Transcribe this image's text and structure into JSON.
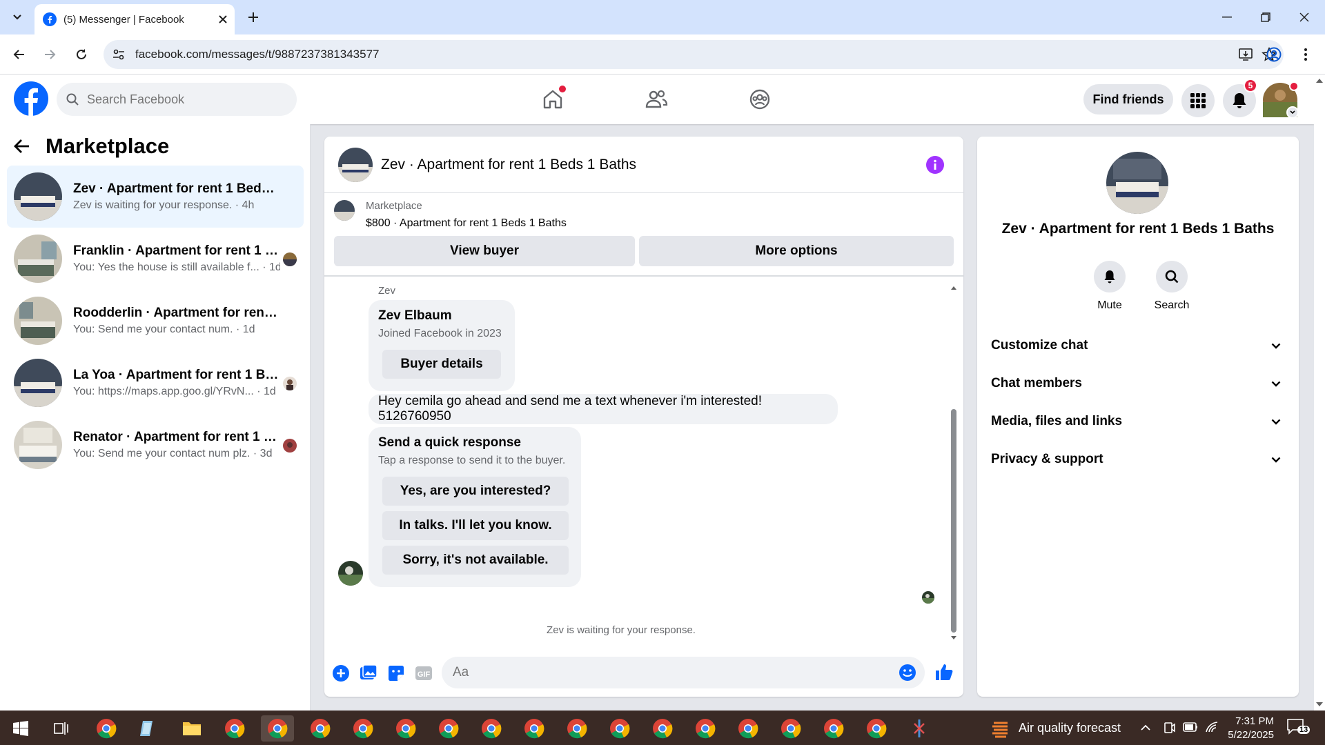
{
  "browser": {
    "tab_title": "(5) Messenger | Facebook",
    "url": "facebook.com/messages/t/9887237381343577"
  },
  "header": {
    "search_placeholder": "Search Facebook",
    "find_friends_label": "Find friends",
    "notification_count": "5"
  },
  "sidebar": {
    "title": "Marketplace",
    "conversations": [
      {
        "name": "Zev · Apartment for rent 1 Beds 1 B...",
        "snippet": "Zev is waiting for your response. · 4h",
        "active": true
      },
      {
        "name": "Franklin · Apartment for rent 1 B...",
        "snippet": "You: Yes the house is still available f... · 1d"
      },
      {
        "name": "Roodderlin · Apartment for rent 1 ...",
        "snippet": "You: Send me your contact num. · 1d"
      },
      {
        "name": "La Yoa · Apartment for rent 1 Be...",
        "snippet": "You: https://maps.app.goo.gl/YRvN... · 1d"
      },
      {
        "name": "Renator · Apartment for rent 1 B...",
        "snippet": "You: Send me your contact num plz. · 3d"
      }
    ]
  },
  "chat": {
    "title": "Zev · Apartment for rent 1 Beds 1 Baths",
    "listing_source": "Marketplace",
    "listing_text": "$800 · Apartment for rent 1 Beds 1 Baths",
    "view_buyer_label": "View buyer",
    "more_options_label": "More options",
    "sender_label": "Zev",
    "buyer_name": "Zev Elbaum",
    "buyer_joined": "Joined Facebook in 2023",
    "buyer_details_label": "Buyer details",
    "message_text": "Hey cemila go ahead and send me a text whenever i'm interested! 5126760950",
    "quick_title": "Send a quick response",
    "quick_subtitle": "Tap a response to send it to the buyer.",
    "quick_responses": [
      "Yes, are you interested?",
      "In talks. I'll let you know.",
      "Sorry, it's not available."
    ],
    "waiting_text": "Zev is waiting for your response.",
    "composer_placeholder": "Aa"
  },
  "details": {
    "title": "Zev · Apartment for rent 1 Beds 1 Baths",
    "mute_label": "Mute",
    "search_label": "Search",
    "sections": [
      "Customize chat",
      "Chat members",
      "Media, files and links",
      "Privacy & support"
    ]
  },
  "taskbar": {
    "weather_text": "Air quality forecast",
    "time": "7:31 PM",
    "date": "5/22/2025",
    "notif_count": "13"
  },
  "colors": {
    "fb_blue": "#0866ff",
    "accent_purple": "#a033ff",
    "active_conv_bg": "#ebf5ff"
  }
}
